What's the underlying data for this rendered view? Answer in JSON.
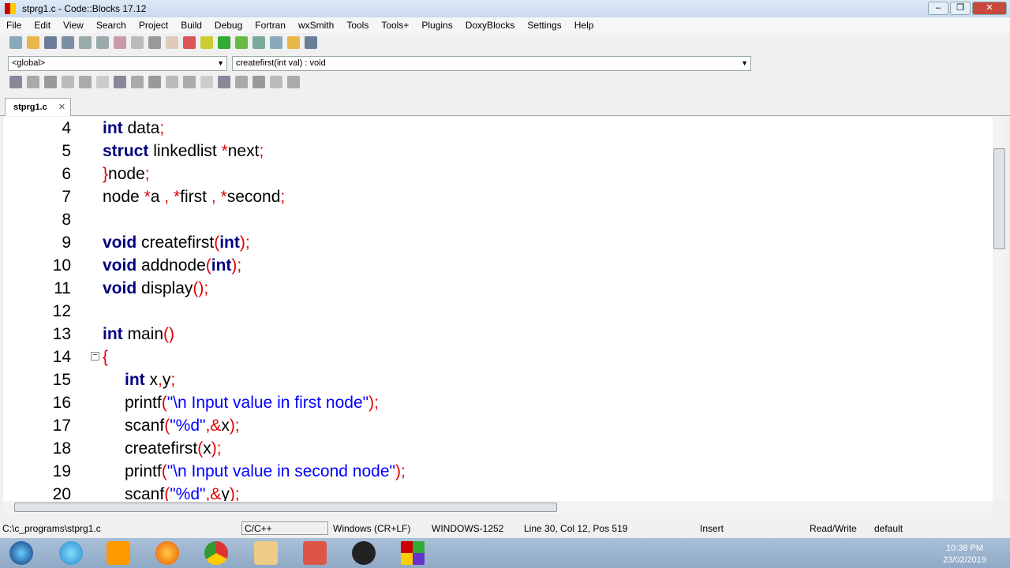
{
  "window": {
    "title": "stprg1.c - Code::Blocks 17.12",
    "minimize": "–",
    "maximize": "❐",
    "close": "✕"
  },
  "menu": [
    "File",
    "Edit",
    "View",
    "Search",
    "Project",
    "Build",
    "Debug",
    "Fortran",
    "wxSmith",
    "Tools",
    "Tools+",
    "Plugins",
    "DoxyBlocks",
    "Settings",
    "Help"
  ],
  "code_toolbar": {
    "scope": "<global>",
    "function": "createfirst(int val) : void"
  },
  "tab": {
    "label": "stprg1.c",
    "close": "✕"
  },
  "editor": {
    "lines": [
      {
        "n": "4",
        "indent": 0,
        "t": [
          [
            "kw",
            "int"
          ],
          [
            "p",
            " data"
          ],
          [
            "op",
            ";"
          ]
        ]
      },
      {
        "n": "5",
        "indent": 0,
        "t": [
          [
            "kw",
            "struct"
          ],
          [
            "p",
            " linkedlist "
          ],
          [
            "op",
            "*"
          ],
          [
            "p",
            "next"
          ],
          [
            "op",
            ";"
          ]
        ]
      },
      {
        "n": "6",
        "indent": 0,
        "t": [
          [
            "op",
            "}"
          ],
          [
            "p",
            "node"
          ],
          [
            "op",
            ";"
          ]
        ]
      },
      {
        "n": "7",
        "indent": 0,
        "t": [
          [
            "p",
            "node "
          ],
          [
            "op",
            "*"
          ],
          [
            "p",
            "a "
          ],
          [
            "op",
            ","
          ],
          [
            "p",
            " "
          ],
          [
            "op",
            "*"
          ],
          [
            "p",
            "first "
          ],
          [
            "op",
            ","
          ],
          [
            "p",
            " "
          ],
          [
            "op",
            "*"
          ],
          [
            "p",
            "second"
          ],
          [
            "op",
            ";"
          ]
        ]
      },
      {
        "n": "8",
        "indent": 0,
        "t": []
      },
      {
        "n": "9",
        "indent": 0,
        "t": [
          [
            "kw",
            "void"
          ],
          [
            "p",
            " createfirst"
          ],
          [
            "op",
            "("
          ],
          [
            "kw",
            "int"
          ],
          [
            "op",
            ");"
          ]
        ]
      },
      {
        "n": "10",
        "indent": 0,
        "t": [
          [
            "kw",
            "void"
          ],
          [
            "p",
            " addnode"
          ],
          [
            "op",
            "("
          ],
          [
            "kw",
            "int"
          ],
          [
            "op",
            ");"
          ]
        ]
      },
      {
        "n": "11",
        "indent": 0,
        "t": [
          [
            "kw",
            "void"
          ],
          [
            "p",
            " display"
          ],
          [
            "op",
            "();"
          ]
        ]
      },
      {
        "n": "12",
        "indent": 0,
        "t": []
      },
      {
        "n": "13",
        "indent": 0,
        "t": [
          [
            "kw",
            "int"
          ],
          [
            "p",
            " main"
          ],
          [
            "op",
            "()"
          ]
        ]
      },
      {
        "n": "14",
        "indent": 0,
        "fold": "−",
        "t": [
          [
            "op",
            "{"
          ]
        ]
      },
      {
        "n": "15",
        "indent": 1,
        "t": [
          [
            "kw",
            "int"
          ],
          [
            "p",
            " x"
          ],
          [
            "op",
            ","
          ],
          [
            "p",
            "y"
          ],
          [
            "op",
            ";"
          ]
        ]
      },
      {
        "n": "16",
        "indent": 1,
        "t": [
          [
            "p",
            "printf"
          ],
          [
            "op",
            "("
          ],
          [
            "str",
            "\"\\n Input value in first node\""
          ],
          [
            "op",
            ");"
          ]
        ]
      },
      {
        "n": "17",
        "indent": 1,
        "t": [
          [
            "p",
            "scanf"
          ],
          [
            "op",
            "("
          ],
          [
            "str",
            "\"%d\""
          ],
          [
            "op",
            ",&"
          ],
          [
            "p",
            "x"
          ],
          [
            "op",
            ");"
          ]
        ]
      },
      {
        "n": "18",
        "indent": 1,
        "t": [
          [
            "p",
            "createfirst"
          ],
          [
            "op",
            "("
          ],
          [
            "p",
            "x"
          ],
          [
            "op",
            ");"
          ]
        ]
      },
      {
        "n": "19",
        "indent": 1,
        "t": [
          [
            "p",
            "printf"
          ],
          [
            "op",
            "("
          ],
          [
            "str",
            "\"\\n Input value in second node\""
          ],
          [
            "op",
            ");"
          ]
        ]
      },
      {
        "n": "20",
        "indent": 1,
        "t": [
          [
            "p",
            "scanf"
          ],
          [
            "op",
            "("
          ],
          [
            "str",
            "\"%d\""
          ],
          [
            "op",
            ",&"
          ],
          [
            "p",
            "y"
          ],
          [
            "op",
            ");"
          ]
        ]
      }
    ]
  },
  "status": {
    "path": "C:\\c_programs\\stprg1.c",
    "language": "C/C++",
    "eol": "Windows (CR+LF)",
    "encoding": "WINDOWS-1252",
    "position": "Line 30, Col 12, Pos 519",
    "mode": "Insert",
    "access": "Read/Write",
    "profile": "default"
  },
  "taskbar": {
    "time": "10:38 PM",
    "date": "23/02/2019"
  },
  "colors": {
    "keyword": "#00007f",
    "operator": "#e00000",
    "string": "#0000ff"
  }
}
